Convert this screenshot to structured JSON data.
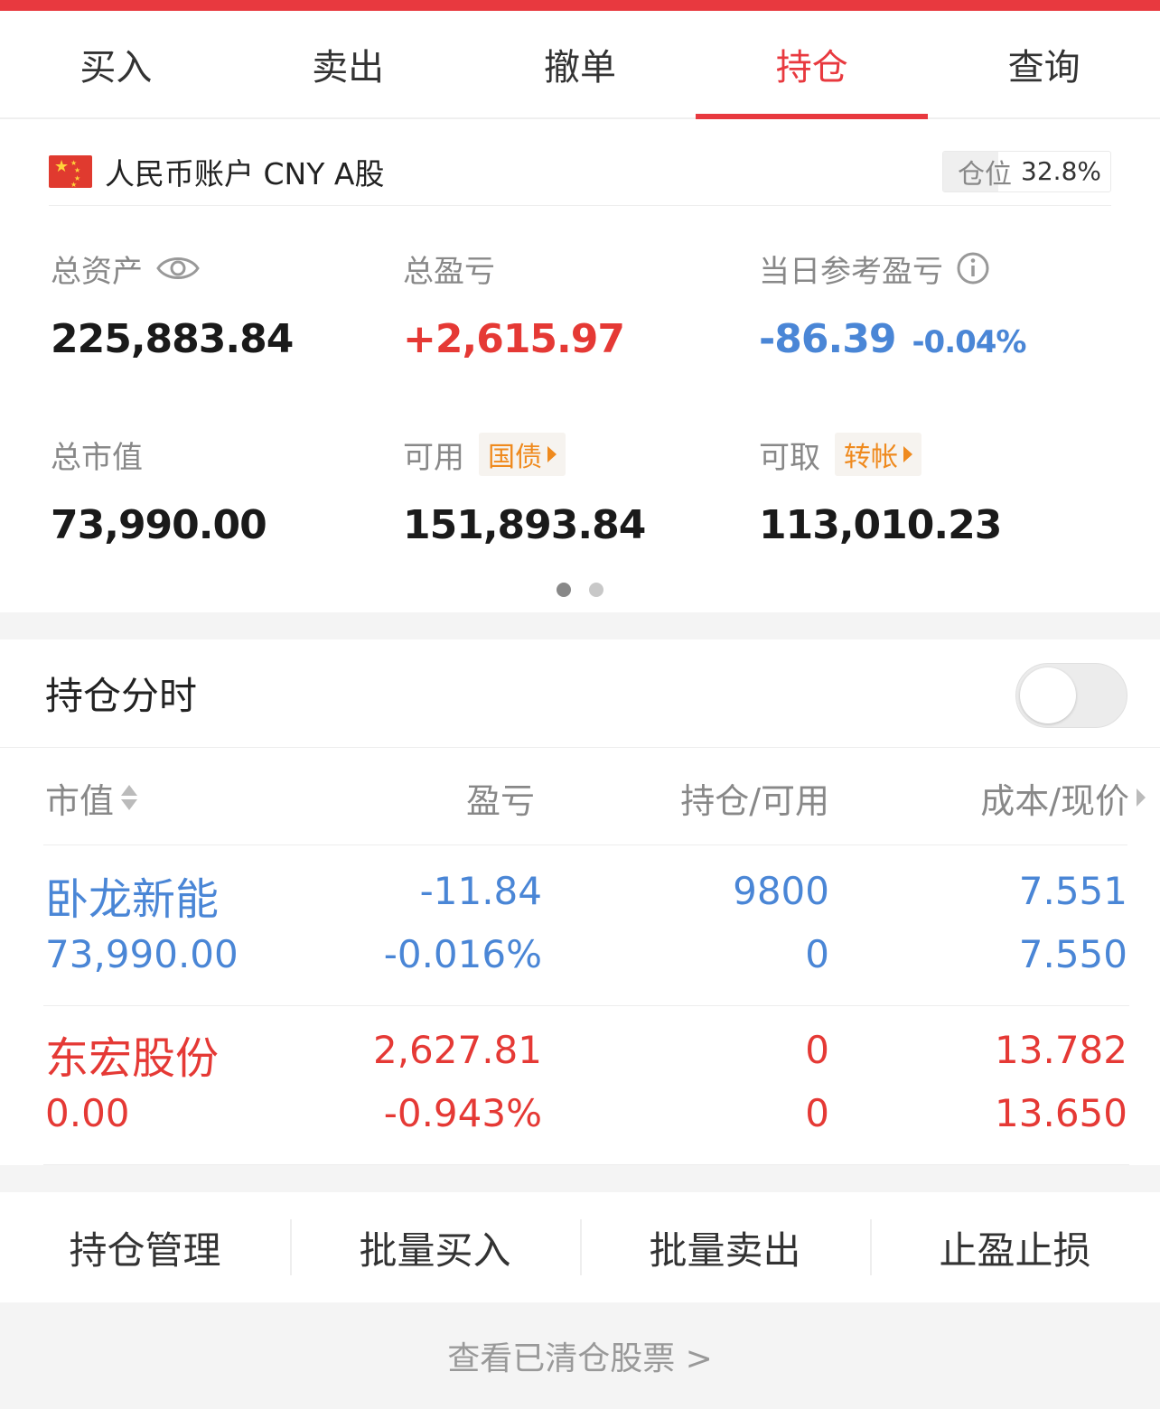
{
  "tabs": [
    {
      "label": "买入"
    },
    {
      "label": "卖出"
    },
    {
      "label": "撤单"
    },
    {
      "label": "持仓",
      "active": true
    },
    {
      "label": "查询"
    }
  ],
  "account": {
    "name": "人民币账户 CNY A股",
    "position_label": "仓位",
    "position_value": "32.8%",
    "position_fraction": 0.328
  },
  "metrics": {
    "total_assets": {
      "label": "总资产",
      "value": "225,883.84"
    },
    "total_pl": {
      "label": "总盈亏",
      "value": "+2,615.97"
    },
    "daily_pl": {
      "label": "当日参考盈亏",
      "value": "-86.39",
      "pct": "-0.04%"
    },
    "market_value": {
      "label": "总市值",
      "value": "73,990.00"
    },
    "available": {
      "label": "可用",
      "tag": "国债",
      "value": "151,893.84"
    },
    "withdrawable": {
      "label": "可取",
      "tag": "转帐",
      "value": "113,010.23"
    }
  },
  "carousel": {
    "pages": 2,
    "current": 0
  },
  "timeshare": {
    "title": "持仓分时",
    "enabled": false
  },
  "table": {
    "headers": {
      "market_value": "市值",
      "pl": "盈亏",
      "holding": "持仓/可用",
      "price": "成本/现价"
    },
    "rows": [
      {
        "name": "卧龙新能",
        "market_value": "73,990.00",
        "pl": "-11.84",
        "pl_pct": "-0.016%",
        "holding": "9800",
        "available": "0",
        "cost": "7.551",
        "price": "7.550",
        "color": "#4a86d6"
      },
      {
        "name": "东宏股份",
        "market_value": "0.00",
        "pl": "2,627.81",
        "pl_pct": "-0.943%",
        "holding": "0",
        "available": "0",
        "cost": "13.782",
        "price": "13.650",
        "color": "#e53935"
      }
    ]
  },
  "actions": [
    {
      "label": "持仓管理"
    },
    {
      "label": "批量买入"
    },
    {
      "label": "批量卖出"
    },
    {
      "label": "止盈止损"
    }
  ],
  "footer": {
    "link": "查看已清仓股票 >"
  },
  "colors": {
    "accent": "#e8393f",
    "loss": "#4a86d6",
    "gain": "#e53935",
    "tag": "#ef8a1e"
  }
}
